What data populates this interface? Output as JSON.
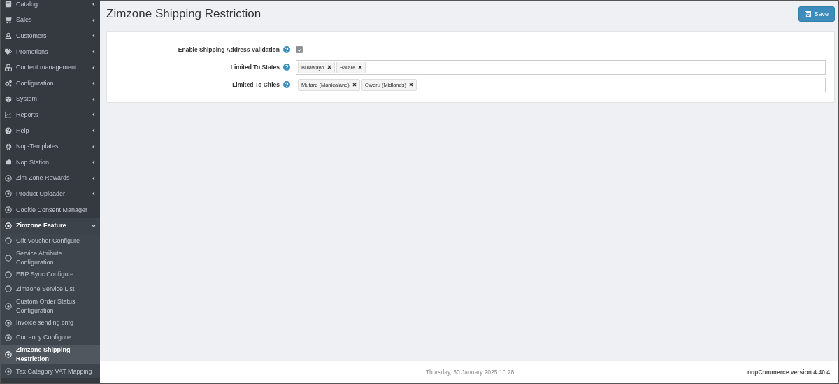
{
  "sidebar": {
    "items": [
      {
        "label": "Catalog",
        "kind": "book",
        "expanded": false,
        "selected": false
      },
      {
        "label": "Sales",
        "kind": "cart",
        "expanded": false,
        "selected": false
      },
      {
        "label": "Customers",
        "kind": "user",
        "expanded": false,
        "selected": false
      },
      {
        "label": "Promotions",
        "kind": "tags",
        "expanded": false,
        "selected": false
      },
      {
        "label": "Content management",
        "kind": "cubes",
        "expanded": false,
        "selected": false
      },
      {
        "label": "Configuration",
        "kind": "gears",
        "expanded": false,
        "selected": false
      },
      {
        "label": "System",
        "kind": "cube",
        "expanded": false,
        "selected": false
      },
      {
        "label": "Reports",
        "kind": "chart",
        "expanded": false,
        "selected": false
      },
      {
        "label": "Help",
        "kind": "question",
        "expanded": false,
        "selected": false
      },
      {
        "label": "Nop-Templates",
        "kind": "gear",
        "expanded": false,
        "selected": false
      },
      {
        "label": "Nop Station",
        "kind": "cloud",
        "expanded": false,
        "selected": false
      },
      {
        "label": "Zim-Zone Rewards",
        "kind": "dot",
        "expanded": false,
        "selected": false
      },
      {
        "label": "Product Uploader",
        "kind": "dot",
        "expanded": false,
        "selected": false
      },
      {
        "label": "Cookie Consent Manager",
        "kind": "dot",
        "selected": false
      },
      {
        "label": "Zimzone Feature",
        "kind": "dot",
        "expanded": true,
        "selected": false,
        "children": [
          {
            "label": "Gift Voucher Configure",
            "kind": "circle",
            "selected": false
          },
          {
            "label": "Service Attribute Configuration",
            "kind": "circle",
            "selected": false
          },
          {
            "label": "ERP Sync Configure",
            "kind": "circle",
            "selected": false
          },
          {
            "label": "Zimzone Service List",
            "kind": "circle",
            "selected": false
          },
          {
            "label": "Custom Order Status Configuration",
            "kind": "dot",
            "selected": false
          },
          {
            "label": "Invoice sending cnfg",
            "kind": "dot",
            "selected": false
          },
          {
            "label": "Currency Configure",
            "kind": "dot",
            "selected": false
          },
          {
            "label": "Zimzone Shipping Restriction",
            "kind": "dot",
            "selected": true
          },
          {
            "label": "Tax Category VAT Mapping",
            "kind": "dot",
            "selected": false
          }
        ]
      }
    ]
  },
  "page": {
    "title": "Zimzone Shipping Restriction",
    "save_button": "Save"
  },
  "form": {
    "fields": [
      {
        "label": "Enable Shipping Address Validation",
        "kind": "checkbox",
        "checked": true
      },
      {
        "label": "Limited To States",
        "kind": "tags",
        "tags": [
          "Bulawayo",
          "Harare"
        ]
      },
      {
        "label": "Limited To Cities",
        "kind": "tags",
        "tags": [
          "Mutare (Manicaland)",
          "Gweru (Midlands)"
        ]
      }
    ]
  },
  "footer": {
    "date": "Thursday, 30 January 2025 10:28",
    "version": "nopCommerce version 4.40.4"
  }
}
